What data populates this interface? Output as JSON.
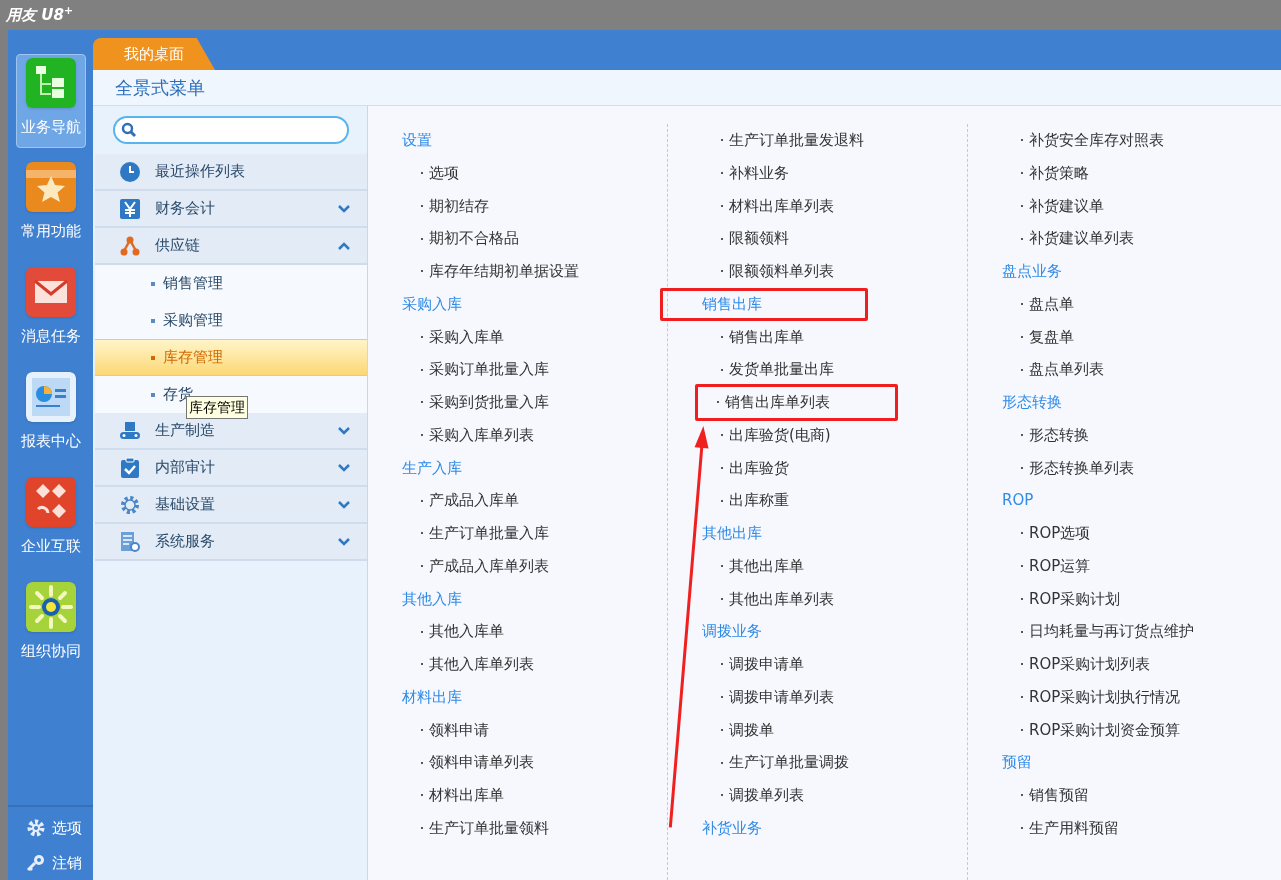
{
  "app_title": "用友 U8$^{+}$",
  "rail": {
    "items": [
      {
        "label": "业务导航",
        "selected": true
      },
      {
        "label": "常用功能",
        "selected": false
      },
      {
        "label": "消息任务",
        "selected": false
      },
      {
        "label": "报表中心",
        "selected": false
      },
      {
        "label": "企业互联",
        "selected": false
      },
      {
        "label": "组织协同",
        "selected": false
      }
    ],
    "bottom": [
      {
        "label": "选项"
      },
      {
        "label": "注销"
      }
    ]
  },
  "tabs": [
    {
      "label": "我的桌面",
      "selected": true
    }
  ],
  "panel_title": "全景式菜单",
  "nav": [
    {
      "label": "最近操作列表"
    },
    {
      "label": "财务会计",
      "expanded": false
    },
    {
      "label": "供应链",
      "expanded": true,
      "children": [
        {
          "label": "销售管理",
          "selected": false
        },
        {
          "label": "采购管理",
          "selected": false
        },
        {
          "label": "库存管理",
          "selected": true
        },
        {
          "label": "存货",
          "selected": false
        }
      ]
    },
    {
      "label": "生产制造",
      "expanded": false
    },
    {
      "label": "内部审计",
      "expanded": false
    },
    {
      "label": "基础设置",
      "expanded": false
    },
    {
      "label": "系统服务",
      "expanded": false
    }
  ],
  "tooltip": "库存管理",
  "menu_columns": [
    [
      {
        "kind": "heading",
        "label": "设置",
        "marked": false
      },
      {
        "kind": "item",
        "label": "选项",
        "marked": false
      },
      {
        "kind": "item",
        "label": "期初结存",
        "marked": false
      },
      {
        "kind": "item",
        "label": "期初不合格品",
        "marked": false
      },
      {
        "kind": "item",
        "label": "库存年结期初单据设置",
        "marked": false
      },
      {
        "kind": "heading",
        "label": "采购入库",
        "marked": false
      },
      {
        "kind": "item",
        "label": "采购入库单",
        "marked": false
      },
      {
        "kind": "item",
        "label": "采购订单批量入库",
        "marked": false
      },
      {
        "kind": "item",
        "label": "采购到货批量入库",
        "marked": false
      },
      {
        "kind": "item",
        "label": "采购入库单列表",
        "marked": false
      },
      {
        "kind": "heading",
        "label": "生产入库",
        "marked": false
      },
      {
        "kind": "item",
        "label": "产成品入库单",
        "marked": false
      },
      {
        "kind": "item",
        "label": "生产订单批量入库",
        "marked": false
      },
      {
        "kind": "item",
        "label": "产成品入库单列表",
        "marked": false
      },
      {
        "kind": "heading",
        "label": "其他入库",
        "marked": false
      },
      {
        "kind": "item",
        "label": "其他入库单",
        "marked": false
      },
      {
        "kind": "item",
        "label": "其他入库单列表",
        "marked": false
      },
      {
        "kind": "heading",
        "label": "材料出库",
        "marked": false
      },
      {
        "kind": "item",
        "label": "领料申请",
        "marked": false
      },
      {
        "kind": "item",
        "label": "领料申请单列表",
        "marked": false
      },
      {
        "kind": "item",
        "label": "材料出库单",
        "marked": false
      },
      {
        "kind": "item",
        "label": "生产订单批量领料",
        "marked": false
      }
    ],
    [
      {
        "kind": "item",
        "label": "生产订单批量发退料",
        "marked": false
      },
      {
        "kind": "item",
        "label": "补料业务",
        "marked": false
      },
      {
        "kind": "item",
        "label": "材料出库单列表",
        "marked": false
      },
      {
        "kind": "item",
        "label": "限额领料",
        "marked": false
      },
      {
        "kind": "item",
        "label": "限额领料单列表",
        "marked": false
      },
      {
        "kind": "heading",
        "label": "销售出库",
        "marked": true
      },
      {
        "kind": "item",
        "label": "销售出库单",
        "marked": false
      },
      {
        "kind": "item",
        "label": "发货单批量出库",
        "marked": false
      },
      {
        "kind": "item",
        "label": "销售出库单列表",
        "marked": true
      },
      {
        "kind": "item",
        "label": "出库验货(电商)",
        "marked": false
      },
      {
        "kind": "item",
        "label": "出库验货",
        "marked": false
      },
      {
        "kind": "item",
        "label": "出库称重",
        "marked": false
      },
      {
        "kind": "heading",
        "label": "其他出库",
        "marked": false
      },
      {
        "kind": "item",
        "label": "其他出库单",
        "marked": false
      },
      {
        "kind": "item",
        "label": "其他出库单列表",
        "marked": false
      },
      {
        "kind": "heading",
        "label": "调拨业务",
        "marked": false
      },
      {
        "kind": "item",
        "label": "调拨申请单",
        "marked": false
      },
      {
        "kind": "item",
        "label": "调拨申请单列表",
        "marked": false
      },
      {
        "kind": "item",
        "label": "调拨单",
        "marked": false
      },
      {
        "kind": "item",
        "label": "生产订单批量调拨",
        "marked": false
      },
      {
        "kind": "item",
        "label": "调拨单列表",
        "marked": false
      },
      {
        "kind": "heading",
        "label": "补货业务",
        "marked": false
      }
    ],
    [
      {
        "kind": "item",
        "label": "补货安全库存对照表",
        "marked": false
      },
      {
        "kind": "item",
        "label": "补货策略",
        "marked": false
      },
      {
        "kind": "item",
        "label": "补货建议单",
        "marked": false
      },
      {
        "kind": "item",
        "label": "补货建议单列表",
        "marked": false
      },
      {
        "kind": "heading",
        "label": "盘点业务",
        "marked": false
      },
      {
        "kind": "item",
        "label": "盘点单",
        "marked": false
      },
      {
        "kind": "item",
        "label": "复盘单",
        "marked": false
      },
      {
        "kind": "item",
        "label": "盘点单列表",
        "marked": false
      },
      {
        "kind": "heading",
        "label": "形态转换",
        "marked": false
      },
      {
        "kind": "item",
        "label": "形态转换",
        "marked": false
      },
      {
        "kind": "item",
        "label": "形态转换单列表",
        "marked": false
      },
      {
        "kind": "heading",
        "label": "ROP",
        "marked": false
      },
      {
        "kind": "item",
        "label": "ROP选项",
        "marked": false
      },
      {
        "kind": "item",
        "label": "ROP运算",
        "marked": false
      },
      {
        "kind": "item",
        "label": "ROP采购计划",
        "marked": false
      },
      {
        "kind": "item",
        "label": "日均耗量与再订货点维护",
        "marked": false
      },
      {
        "kind": "item",
        "label": "ROP采购计划列表",
        "marked": false
      },
      {
        "kind": "item",
        "label": "ROP采购计划执行情况",
        "marked": false
      },
      {
        "kind": "item",
        "label": "ROP采购计划资金预算",
        "marked": false
      },
      {
        "kind": "heading",
        "label": "预留",
        "marked": false
      },
      {
        "kind": "item",
        "label": "销售预留",
        "marked": false
      },
      {
        "kind": "item",
        "label": "生产用料预留",
        "marked": false
      }
    ]
  ]
}
